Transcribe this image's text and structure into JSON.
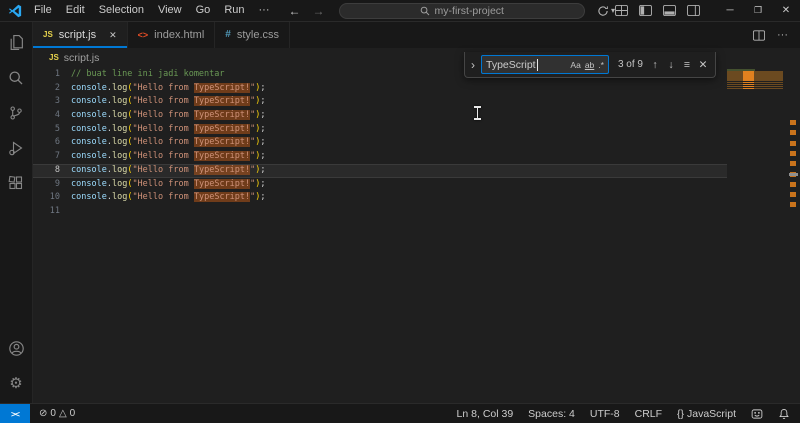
{
  "titlebar": {
    "menus": [
      "File",
      "Edit",
      "Selection",
      "View",
      "Go",
      "Run",
      "···"
    ],
    "search_text": "my-first-project"
  },
  "tabs": [
    {
      "label": "script.js",
      "icon": "js-file-icon",
      "active": true
    },
    {
      "label": "index.html",
      "icon": "html-file-icon",
      "active": false
    },
    {
      "label": "style.css",
      "icon": "css-file-icon",
      "active": false
    }
  ],
  "breadcrumb": {
    "icon": "js-file-icon",
    "label": "script.js"
  },
  "activitybar": {
    "top": [
      "explorer-icon",
      "search-icon",
      "source-control-icon",
      "run-debug-icon",
      "extensions-icon"
    ],
    "bottom": [
      "account-icon",
      "settings-gear-icon"
    ]
  },
  "find": {
    "query": "TypeScript",
    "match_case": "Aa",
    "whole_word": "ab",
    "regex": ".*",
    "results": "3 of 9",
    "actions": [
      "previous-match",
      "next-match",
      "find-in-selection",
      "close"
    ]
  },
  "editor": {
    "active_line": 8,
    "lines": [
      {
        "num": 1,
        "segments": [
          {
            "text": "// buat line ini jadi komentar",
            "style": "comment"
          }
        ]
      },
      {
        "num": 2,
        "segments": [
          {
            "text": "console",
            "style": "var"
          },
          {
            "text": ".",
            "style": "punct"
          },
          {
            "text": "log",
            "style": "fn"
          },
          {
            "text": "(",
            "style": "paren"
          },
          {
            "text": "\"Hello from ",
            "style": "str"
          },
          {
            "text": "TypeScript!",
            "style": "str",
            "hl": true
          },
          {
            "text": "\"",
            "style": "str"
          },
          {
            "text": ")",
            "style": "paren"
          },
          {
            "text": ";",
            "style": "punct"
          }
        ]
      },
      {
        "num": 3,
        "segments": [
          {
            "text": "console",
            "style": "var"
          },
          {
            "text": ".",
            "style": "punct"
          },
          {
            "text": "log",
            "style": "fn"
          },
          {
            "text": "(",
            "style": "paren"
          },
          {
            "text": "\"Hello from ",
            "style": "str"
          },
          {
            "text": "TypeScript!",
            "style": "str",
            "hl": true
          },
          {
            "text": "\"",
            "style": "str"
          },
          {
            "text": ")",
            "style": "paren"
          },
          {
            "text": ";",
            "style": "punct"
          }
        ]
      },
      {
        "num": 4,
        "segments": [
          {
            "text": "console",
            "style": "var"
          },
          {
            "text": ".",
            "style": "punct"
          },
          {
            "text": "log",
            "style": "fn"
          },
          {
            "text": "(",
            "style": "paren"
          },
          {
            "text": "\"Hello from ",
            "style": "str"
          },
          {
            "text": "TypeScript!",
            "style": "str",
            "hl": true
          },
          {
            "text": "\"",
            "style": "str"
          },
          {
            "text": ")",
            "style": "paren"
          },
          {
            "text": ";",
            "style": "punct"
          }
        ]
      },
      {
        "num": 5,
        "segments": [
          {
            "text": "console",
            "style": "var"
          },
          {
            "text": ".",
            "style": "punct"
          },
          {
            "text": "log",
            "style": "fn"
          },
          {
            "text": "(",
            "style": "paren"
          },
          {
            "text": "\"Hello from ",
            "style": "str"
          },
          {
            "text": "TypeScript!",
            "style": "str",
            "hl": true
          },
          {
            "text": "\"",
            "style": "str"
          },
          {
            "text": ")",
            "style": "paren"
          },
          {
            "text": ";",
            "style": "punct"
          }
        ]
      },
      {
        "num": 6,
        "segments": [
          {
            "text": "console",
            "style": "var"
          },
          {
            "text": ".",
            "style": "punct"
          },
          {
            "text": "log",
            "style": "fn"
          },
          {
            "text": "(",
            "style": "paren"
          },
          {
            "text": "\"Hello from ",
            "style": "str"
          },
          {
            "text": "TypeScript!",
            "style": "str",
            "hl": true
          },
          {
            "text": "\"",
            "style": "str"
          },
          {
            "text": ")",
            "style": "paren"
          },
          {
            "text": ";",
            "style": "punct"
          }
        ]
      },
      {
        "num": 7,
        "segments": [
          {
            "text": "console",
            "style": "var"
          },
          {
            "text": ".",
            "style": "punct"
          },
          {
            "text": "log",
            "style": "fn"
          },
          {
            "text": "(",
            "style": "paren"
          },
          {
            "text": "\"Hello from ",
            "style": "str"
          },
          {
            "text": "TypeScript!",
            "style": "str",
            "hl": true
          },
          {
            "text": "\"",
            "style": "str"
          },
          {
            "text": ")",
            "style": "paren"
          },
          {
            "text": ";",
            "style": "punct"
          }
        ]
      },
      {
        "num": 8,
        "segments": [
          {
            "text": "console",
            "style": "var"
          },
          {
            "text": ".",
            "style": "punct"
          },
          {
            "text": "log",
            "style": "fn"
          },
          {
            "text": "(",
            "style": "paren"
          },
          {
            "text": "\"Hello from ",
            "style": "str"
          },
          {
            "text": "TypeScript!",
            "style": "str",
            "hl": true
          },
          {
            "text": "\"",
            "style": "str"
          },
          {
            "text": ")",
            "style": "paren"
          },
          {
            "text": ";",
            "style": "punct"
          }
        ]
      },
      {
        "num": 9,
        "segments": [
          {
            "text": "console",
            "style": "var"
          },
          {
            "text": ".",
            "style": "punct"
          },
          {
            "text": "log",
            "style": "fn"
          },
          {
            "text": "(",
            "style": "paren"
          },
          {
            "text": "\"Hello from ",
            "style": "str"
          },
          {
            "text": "TypeScript!",
            "style": "str",
            "hl": true
          },
          {
            "text": "\"",
            "style": "str"
          },
          {
            "text": ")",
            "style": "paren"
          },
          {
            "text": ";",
            "style": "punct"
          }
        ]
      },
      {
        "num": 10,
        "segments": [
          {
            "text": "console",
            "style": "var"
          },
          {
            "text": ".",
            "style": "punct"
          },
          {
            "text": "log",
            "style": "fn"
          },
          {
            "text": "(",
            "style": "paren"
          },
          {
            "text": "\"Hello from ",
            "style": "str"
          },
          {
            "text": "TypeScript!",
            "style": "str",
            "hl": true
          },
          {
            "text": "\"",
            "style": "str"
          },
          {
            "text": ")",
            "style": "paren"
          },
          {
            "text": ";",
            "style": "punct"
          }
        ]
      },
      {
        "num": 11,
        "segments": []
      }
    ]
  },
  "statusbar": {
    "remote_icon": "remote-indicator-icon",
    "errors": "0",
    "warnings": "0",
    "right": [
      {
        "name": "cursor-position",
        "label": "Ln 8, Col 39"
      },
      {
        "name": "indentation",
        "label": "Spaces: 4"
      },
      {
        "name": "encoding",
        "label": "UTF-8"
      },
      {
        "name": "eol-sequence",
        "label": "CRLF"
      },
      {
        "name": "language-mode",
        "label": "{} JavaScript"
      }
    ]
  },
  "colors": {
    "accent": "#0078d4",
    "titlebar_bg": "#181818",
    "editor_bg": "#1f1f1f",
    "find_match_highlight": "#6b3a17",
    "remote_bg": "#0078d4",
    "comment": "#6a9955",
    "variable": "#9cdcfe",
    "function": "#dcdcaa",
    "string": "#ce9178",
    "js_icon": "#e8d44d",
    "html_icon": "#e44d26",
    "css_icon": "#519aba"
  }
}
